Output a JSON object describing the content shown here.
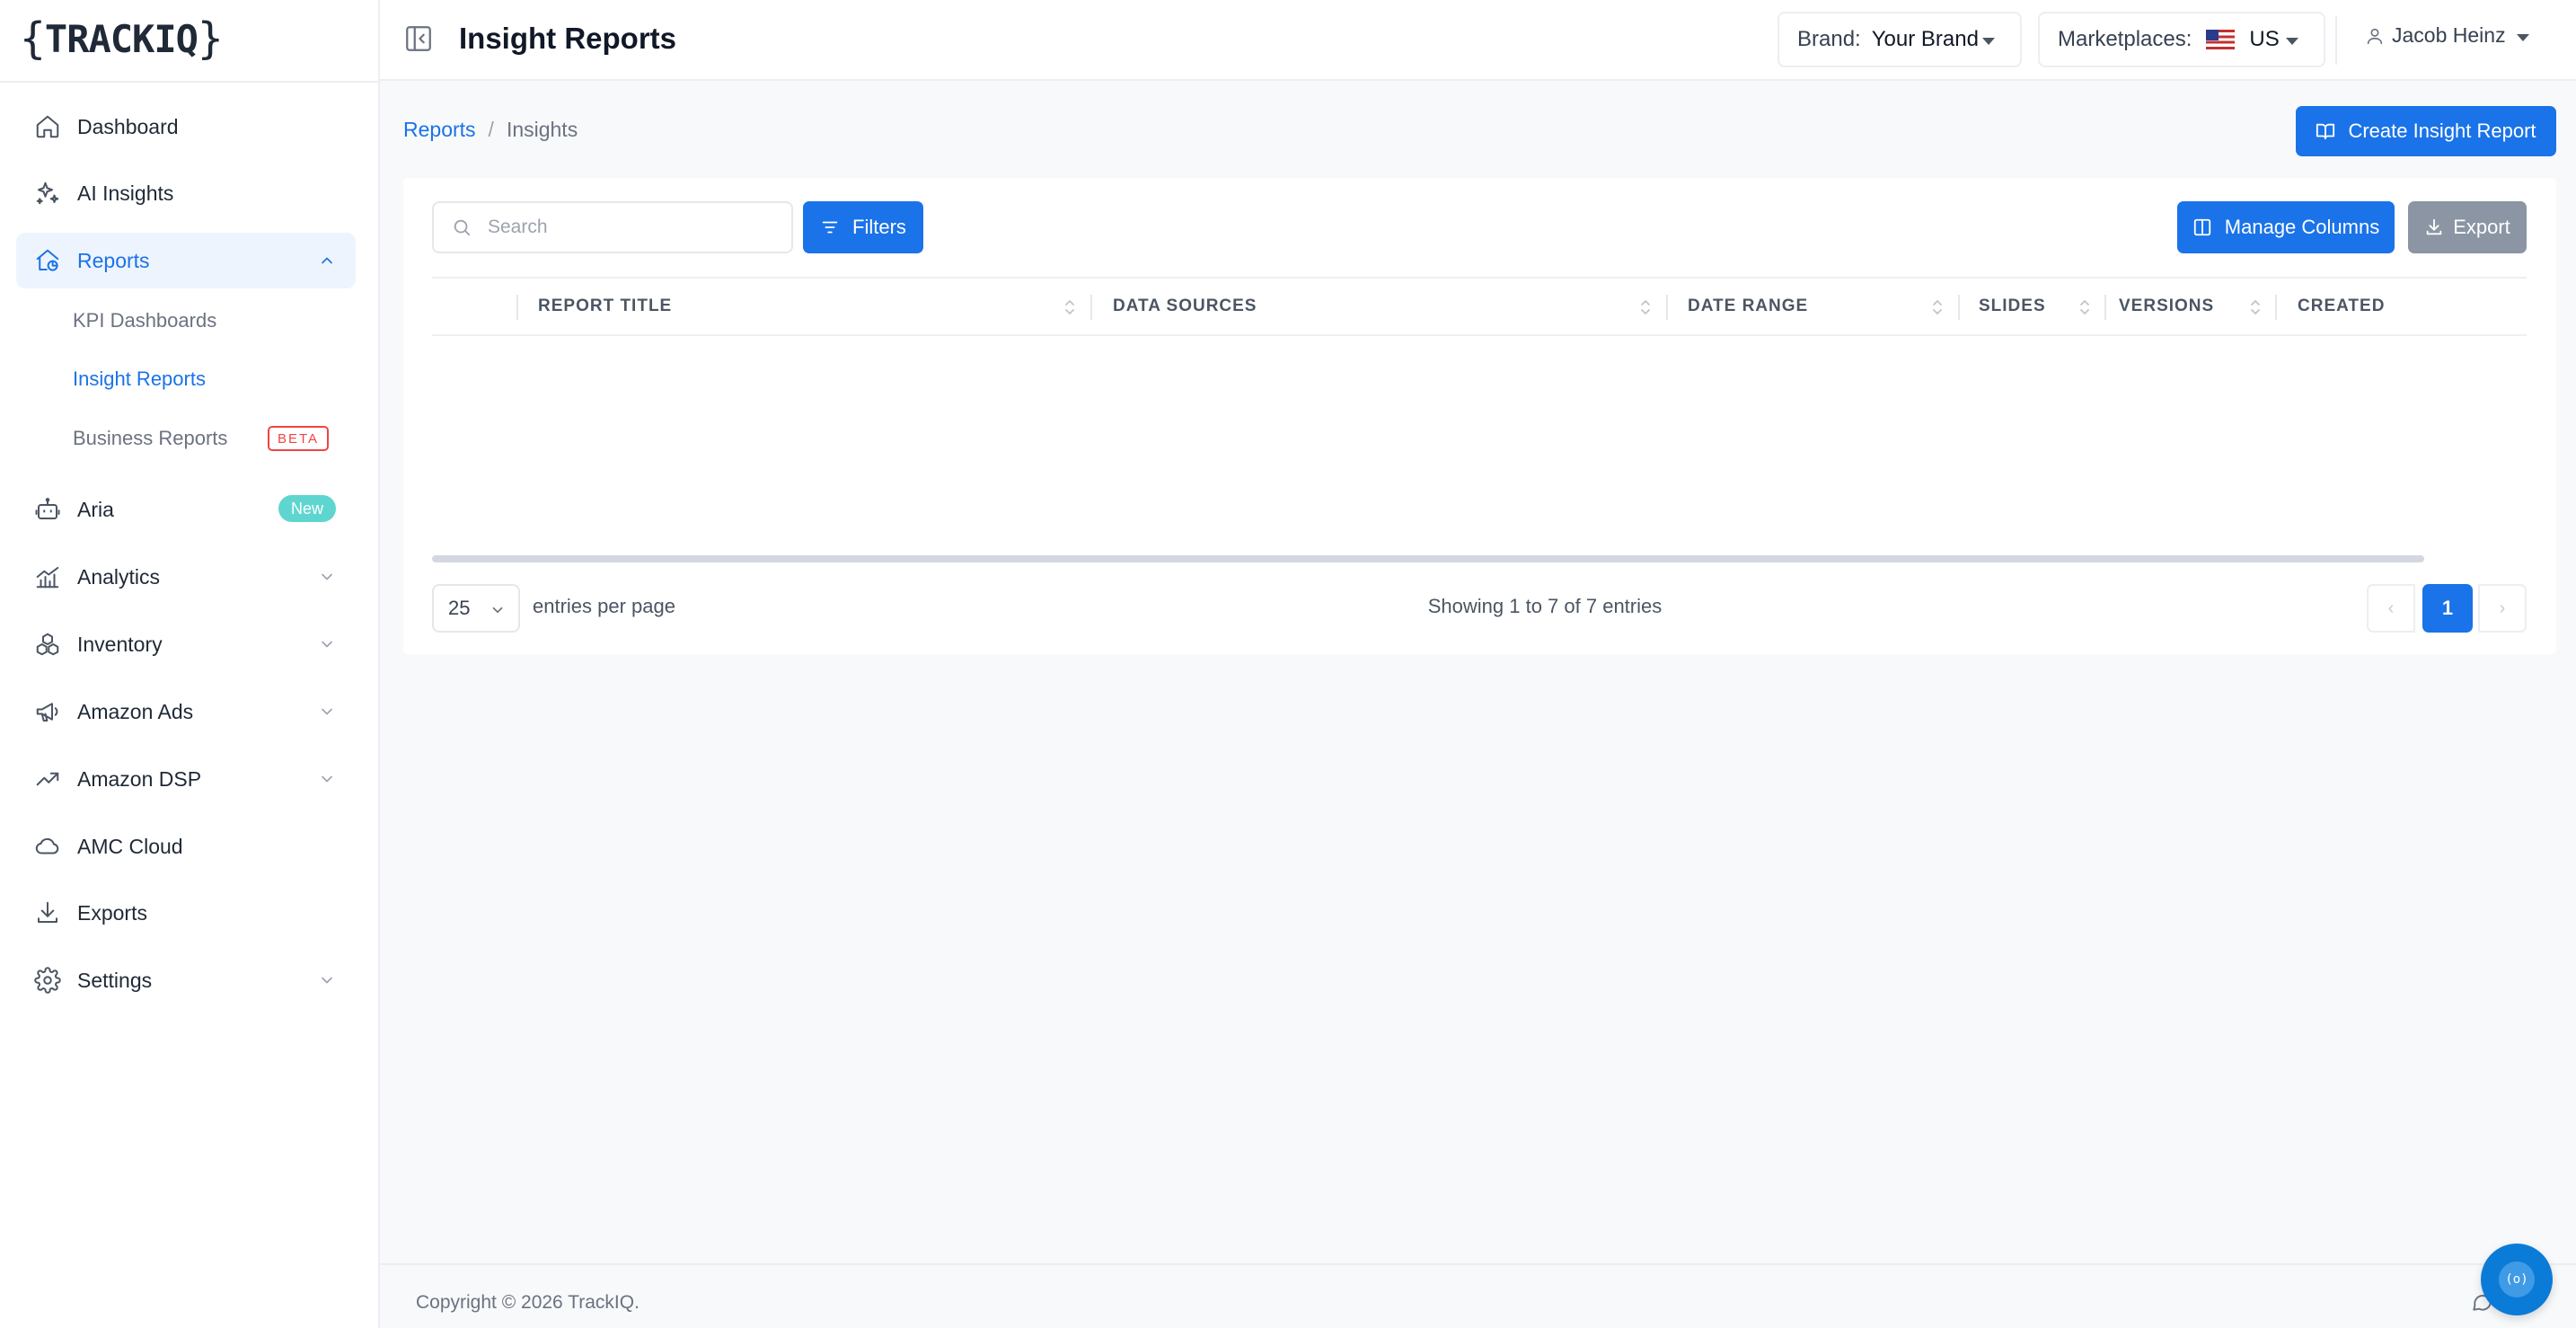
{
  "app": {
    "logo_text": "TRACKIQ",
    "logo_brace_open": "{",
    "logo_brace_close": "}",
    "accent_color": "#1a73e8"
  },
  "sidebar": {
    "items": [
      {
        "label": "Dashboard",
        "icon": "home-icon"
      },
      {
        "label": "AI Insights",
        "icon": "sparkles-icon"
      },
      {
        "label": "Reports",
        "icon": "reports-icon",
        "expanded": true,
        "active": true
      },
      {
        "label": "Aria",
        "icon": "robot-icon",
        "badge": "New"
      },
      {
        "label": "Analytics",
        "icon": "bar-chart-icon"
      },
      {
        "label": "Inventory",
        "icon": "boxes-icon"
      },
      {
        "label": "Amazon Ads",
        "icon": "megaphone-icon"
      },
      {
        "label": "Amazon DSP",
        "icon": "trending-up-icon"
      },
      {
        "label": "AMC Cloud",
        "icon": "cloud-icon"
      },
      {
        "label": "Exports",
        "icon": "download-icon"
      },
      {
        "label": "Settings",
        "icon": "gear-icon"
      }
    ],
    "reports_sub": [
      {
        "label": "KPI Dashboards"
      },
      {
        "label": "Insight Reports",
        "active": true
      },
      {
        "label": "Business Reports",
        "badge": "BETA"
      }
    ]
  },
  "header": {
    "title": "Insight Reports",
    "brand_label": "Brand:",
    "brand_value": "Your Brand",
    "marketplace_label": "Marketplaces:",
    "marketplace_value": "US",
    "user_name": "Jacob Heinz"
  },
  "breadcrumb": {
    "parent": "Reports",
    "separator": "/",
    "current": "Insights"
  },
  "actions": {
    "create_label": "Create Insight Report"
  },
  "toolbar": {
    "search_placeholder": "Search",
    "filters_label": "Filters",
    "manage_columns_label": "Manage Columns",
    "export_label": "Export"
  },
  "table": {
    "columns": [
      "REPORT TITLE",
      "DATA SOURCES",
      "DATE RANGE",
      "SLIDES",
      "VERSIONS",
      "CREATED"
    ],
    "rows": []
  },
  "pagination": {
    "per_page": "25",
    "per_page_label": "entries per page",
    "showing_text": "Showing 1 to 7 of 7 entries",
    "current_page": "1",
    "prev": "‹",
    "next": "›"
  },
  "footer": {
    "copyright": "Copyright © 2026 TrackIQ."
  },
  "chat": {
    "fab_label": "(o)"
  }
}
